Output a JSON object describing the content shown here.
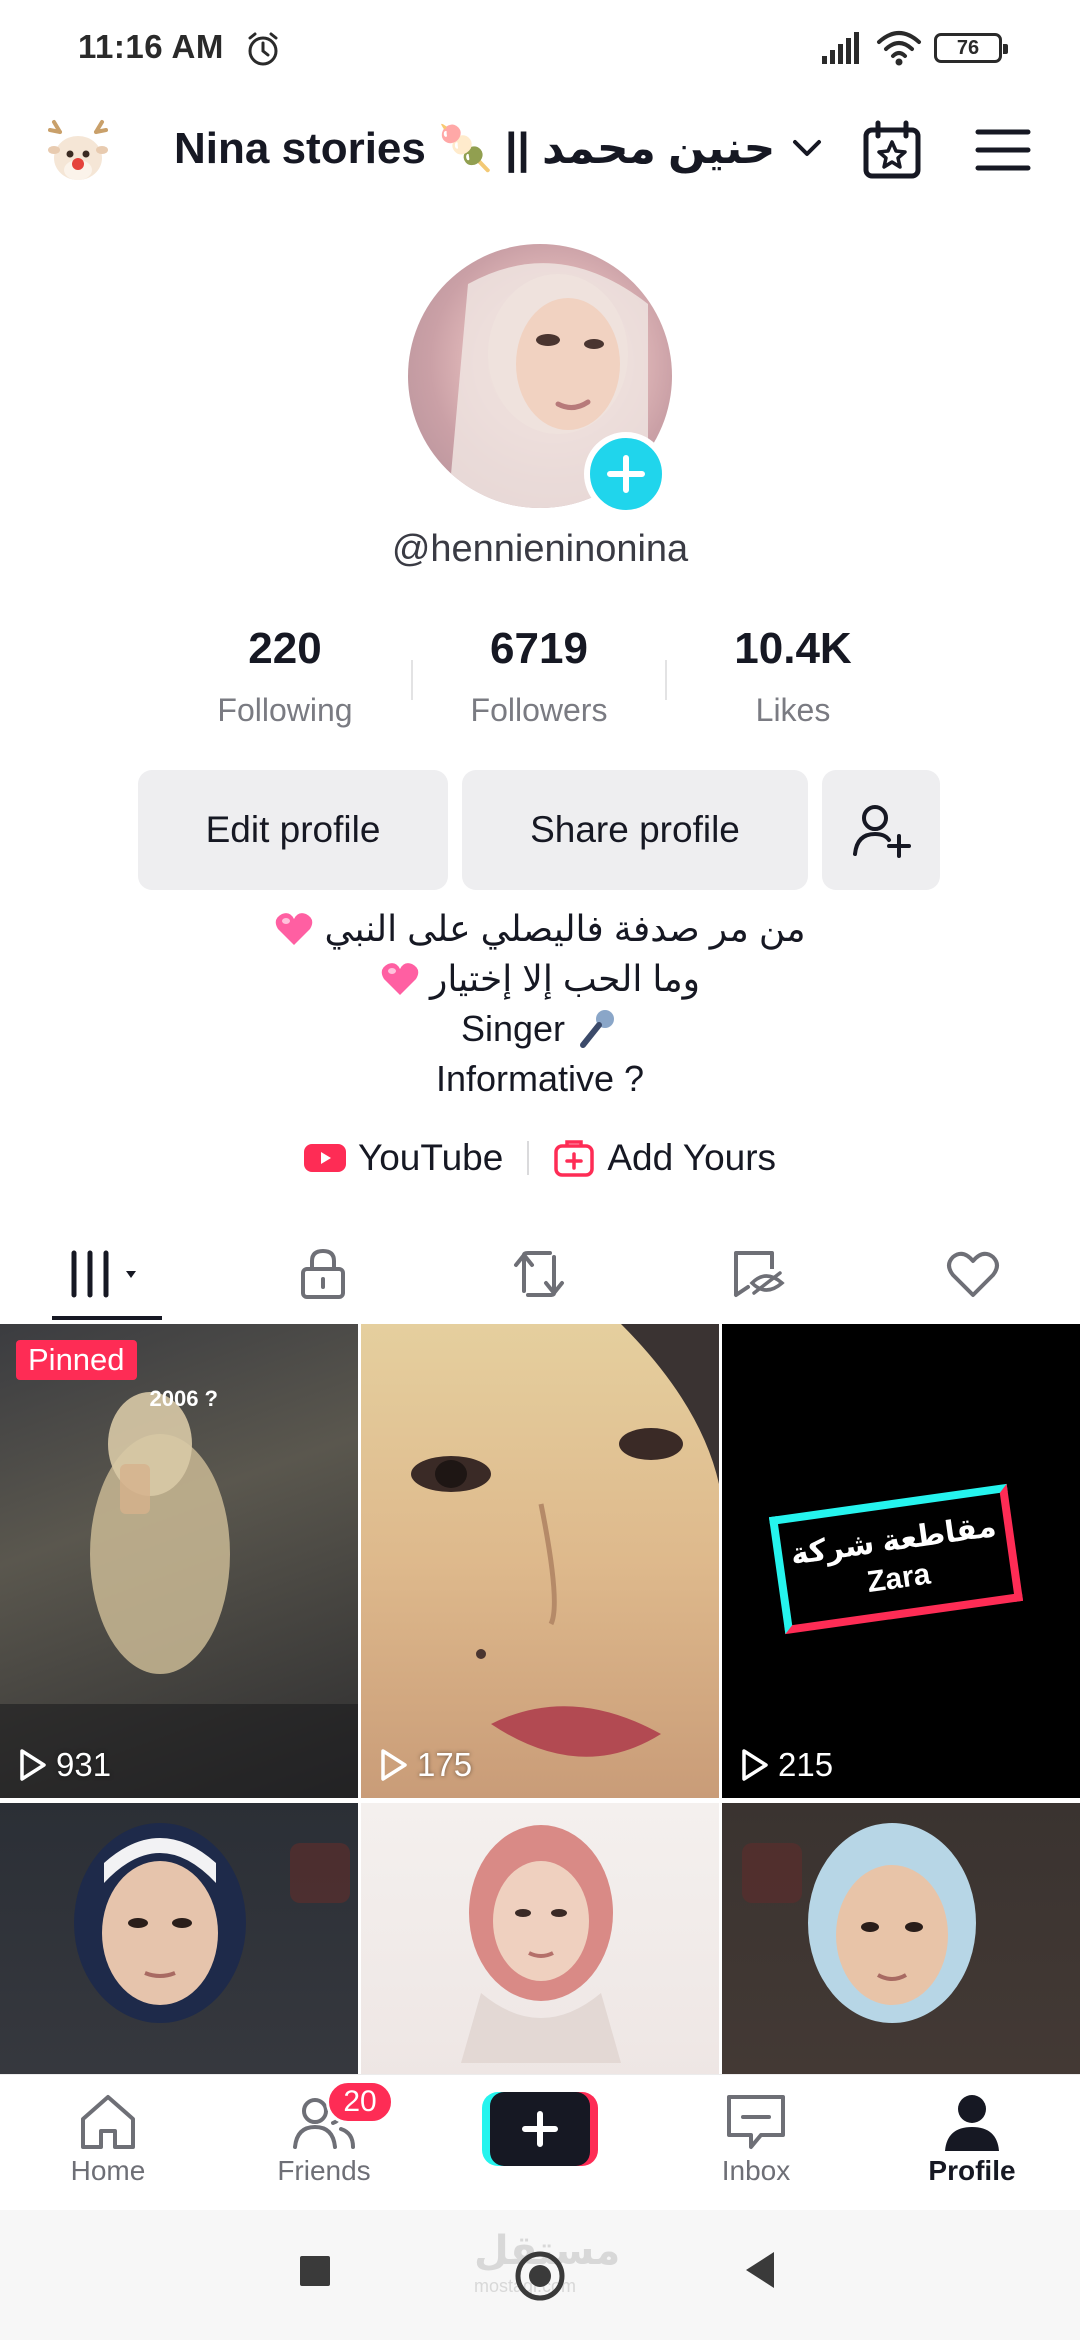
{
  "status_bar": {
    "time": "11:16 AM",
    "battery": "76"
  },
  "header": {
    "account_name": "Nina stories 🍡 || حنين محمد",
    "icons": [
      "reindeer-icon",
      "chevron-down-icon",
      "calendar-star-icon",
      "menu-icon"
    ]
  },
  "profile": {
    "username": "@hennieninonina",
    "stats": [
      {
        "value": "220",
        "label": "Following"
      },
      {
        "value": "6719",
        "label": "Followers"
      },
      {
        "value": "10.4K",
        "label": "Likes"
      }
    ]
  },
  "actions": {
    "edit_profile": "Edit profile",
    "share_profile": "Share profile"
  },
  "bio": {
    "line1": "من مر صدفة فاليصلي على النبي",
    "line2": "وما الحب إلا إختيار",
    "line3": "Singer",
    "line4": "Informative ?"
  },
  "links": {
    "youtube": "YouTube",
    "add_yours": "Add Yours"
  },
  "tabs": [
    "videos-grid-icon",
    "lock-icon",
    "repost-icon",
    "hidden-favorites-icon",
    "liked-heart-icon"
  ],
  "videos": [
    {
      "views": "931",
      "badge": "Pinned",
      "caption": "2006 ?"
    },
    {
      "views": "175"
    },
    {
      "views": "215",
      "overlay_line1": "مقاطعة شركة",
      "overlay_line2": "Zara"
    },
    {
      "views": ""
    },
    {
      "views": ""
    },
    {
      "views": ""
    }
  ],
  "bottom_nav": {
    "home": "Home",
    "friends": "Friends",
    "friends_badge": "20",
    "inbox": "Inbox",
    "profile": "Profile"
  },
  "system_nav": {
    "watermark": "مستقل",
    "watermark_sub": "mostaql.com"
  },
  "colors": {
    "accent_red": "#fe2c55",
    "accent_cyan": "#25f4ee",
    "add_blue": "#20d5ec",
    "text": "#161823"
  }
}
